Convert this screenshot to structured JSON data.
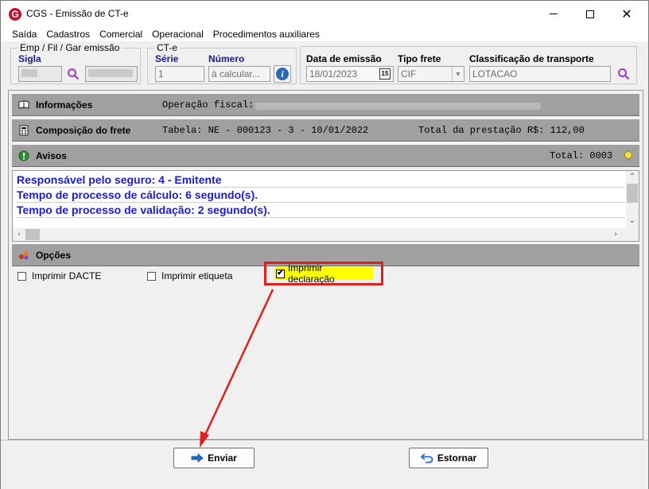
{
  "window": {
    "title": "CGS - Emissão de CT-e",
    "icon_letter": "G"
  },
  "menu": [
    "Saída",
    "Cadastros",
    "Comercial",
    "Operacional",
    "Procedimentos auxiliares"
  ],
  "emp_group": {
    "legend": "Emp / Fil / Gar emissão",
    "sigla_label": "Sigla"
  },
  "cte_group": {
    "legend": "CT-e",
    "serie_label": "Série",
    "serie_value": "1",
    "numero_label": "Número",
    "numero_value": "à calcular..."
  },
  "transport_group": {
    "data_label": "Data de emissão",
    "data_value": "18/01/2023",
    "tipo_label": "Tipo frete",
    "tipo_value": "CIF",
    "classificacao_label": "Classificação de transporte",
    "classificacao_value": "LOTACAO"
  },
  "informacoes": {
    "title": "Informações",
    "operacao_label": "Operação fiscal:"
  },
  "composicao": {
    "title": "Composição do frete",
    "tabela": "Tabela: NE - 000123 - 3 - 10/01/2022",
    "total": "Total da prestação R$: 112,00"
  },
  "avisos": {
    "title": "Avisos",
    "total": "Total: 0003",
    "items": [
      "Responsável pelo seguro: 4 - Emitente",
      "Tempo de processo de cálculo: 6 segundo(s).",
      "Tempo de processo de validação: 2 segundo(s)."
    ]
  },
  "opcoes": {
    "title": "Opções",
    "checkboxes": [
      {
        "label": "Imprimir DACTE",
        "checked": false
      },
      {
        "label": "Imprimir etiqueta",
        "checked": false
      },
      {
        "label": "Imprimir declaração",
        "checked": true
      }
    ]
  },
  "buttons": {
    "enviar": "Enviar",
    "estornar": "Estornar"
  },
  "colors": {
    "highlight": "#ffff00",
    "annotation_red": "#e0201a",
    "aviso_text": "#1b1bd6",
    "section_bar": "#a0a0a0"
  }
}
